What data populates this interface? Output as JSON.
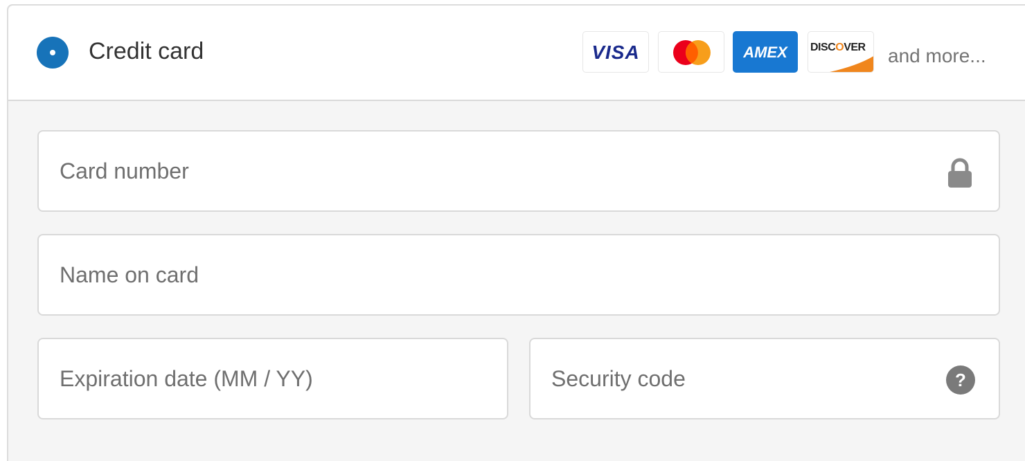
{
  "payment_method": {
    "label": "Credit card",
    "selected": true,
    "accent_color": "#1773b9",
    "card_logos": [
      {
        "name": "visa-logo",
        "text": "VISA"
      },
      {
        "name": "mastercard-logo",
        "text": ""
      },
      {
        "name": "amex-logo",
        "text": "AMEX"
      },
      {
        "name": "discover-logo",
        "text": "DISCOVER"
      }
    ],
    "more_text": "and more..."
  },
  "fields": {
    "card_number": {
      "placeholder": "Card number",
      "value": "",
      "icon": "lock-icon"
    },
    "name_on_card": {
      "placeholder": "Name on card",
      "value": ""
    },
    "expiration": {
      "placeholder": "Expiration date (MM / YY)",
      "value": ""
    },
    "security_code": {
      "placeholder": "Security code",
      "value": "",
      "icon": "question-icon"
    }
  }
}
